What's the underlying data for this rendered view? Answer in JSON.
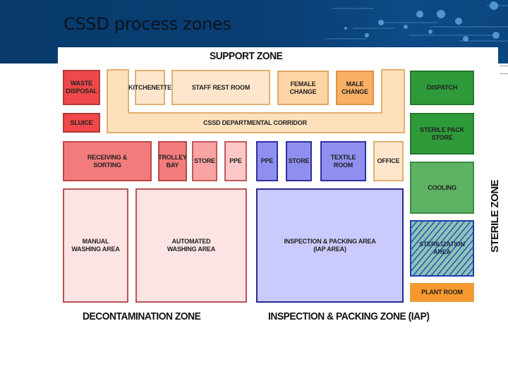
{
  "slide": {
    "title": "CSSD process zones"
  },
  "diagram": {
    "zones": {
      "support": "SUPPORT ZONE",
      "decontamination": "DECONTAMINATION ZONE",
      "inspection_packing": "INSPECTION & PACKING ZONE (IAP)",
      "sterile": "STERILE ZONE"
    },
    "colors": {
      "decontamination": "#f0484a",
      "support": "#fdd4a4",
      "inspection_packing": "#8f8ff0",
      "sterile": "#2e9a3a",
      "plant": "#f79a2e"
    },
    "rooms": {
      "waste_disposal": "WASTE\nDISPOSAL",
      "sluice": "SLUICE",
      "kitchenette": "KITCHENETTE",
      "staff_rest_room": "STAFF REST ROOM",
      "female_change": "FEMALE\nCHANGE",
      "male_change": "MALE\nCHANGE",
      "corridor": "CSSD DEPARTMENTAL CORRIDOR",
      "dispatch": "DISPATCH",
      "sterile_pack_store": "STERILE PACK\nSTORE",
      "receiving_sorting": "RECEIVING &\nSORTING",
      "trolley_bay": "TROLLEY\nBAY",
      "decon_store": "STORE",
      "decon_ppe": "PPE",
      "iap_ppe": "PPE",
      "iap_store": "STORE",
      "textile_room": "TEXTILE\nROOM",
      "office": "OFFICE",
      "cooling": "COOLING",
      "manual_washing": "MANUAL\nWASHING AREA",
      "automated_washing": "AUTOMATED\nWASHING AREA",
      "iap_area": "INSPECTION & PACKING AREA\n(IAP AREA)",
      "sterilization_area": "STERILIZATION\nAREA",
      "plant_room": "PLANT ROOM"
    }
  }
}
